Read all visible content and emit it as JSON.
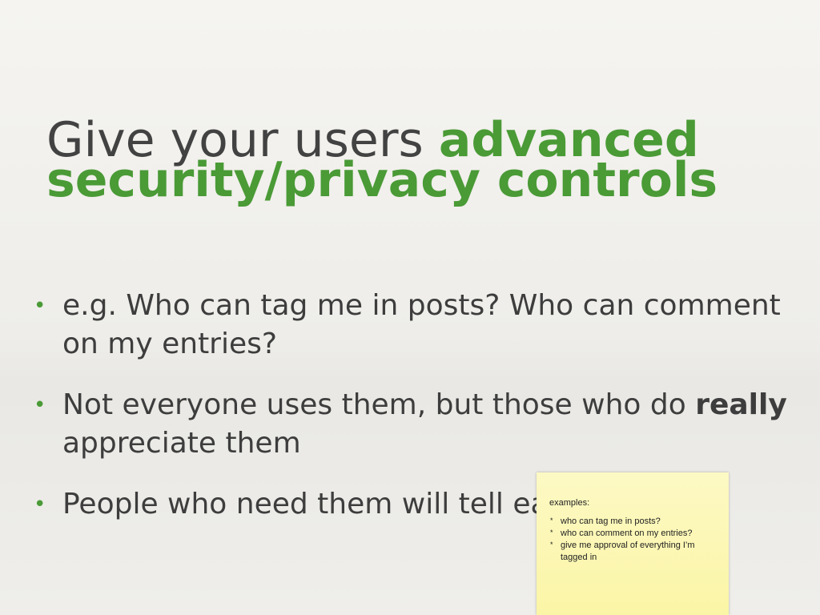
{
  "slide": {
    "title_part1": "Give your users ",
    "title_accent": "advanced security/privacy controls",
    "bullets": [
      {
        "text": "e.g. Who can tag me in posts? Who can comment on my entries?"
      },
      {
        "bold": "really",
        "before": "Not everyone uses them, but those who do ",
        "after": " appreciate them"
      },
      {
        "text": "People who need them will tell each other"
      }
    ]
  },
  "note": {
    "heading": "examples:",
    "items": [
      "who can tag me in posts?",
      "who can comment on my entries?",
      "give me approval of everything I’m tagged in"
    ]
  },
  "colors": {
    "accent": "#4a9a36",
    "text": "#424242",
    "note_bg": "#fbf5a6"
  }
}
